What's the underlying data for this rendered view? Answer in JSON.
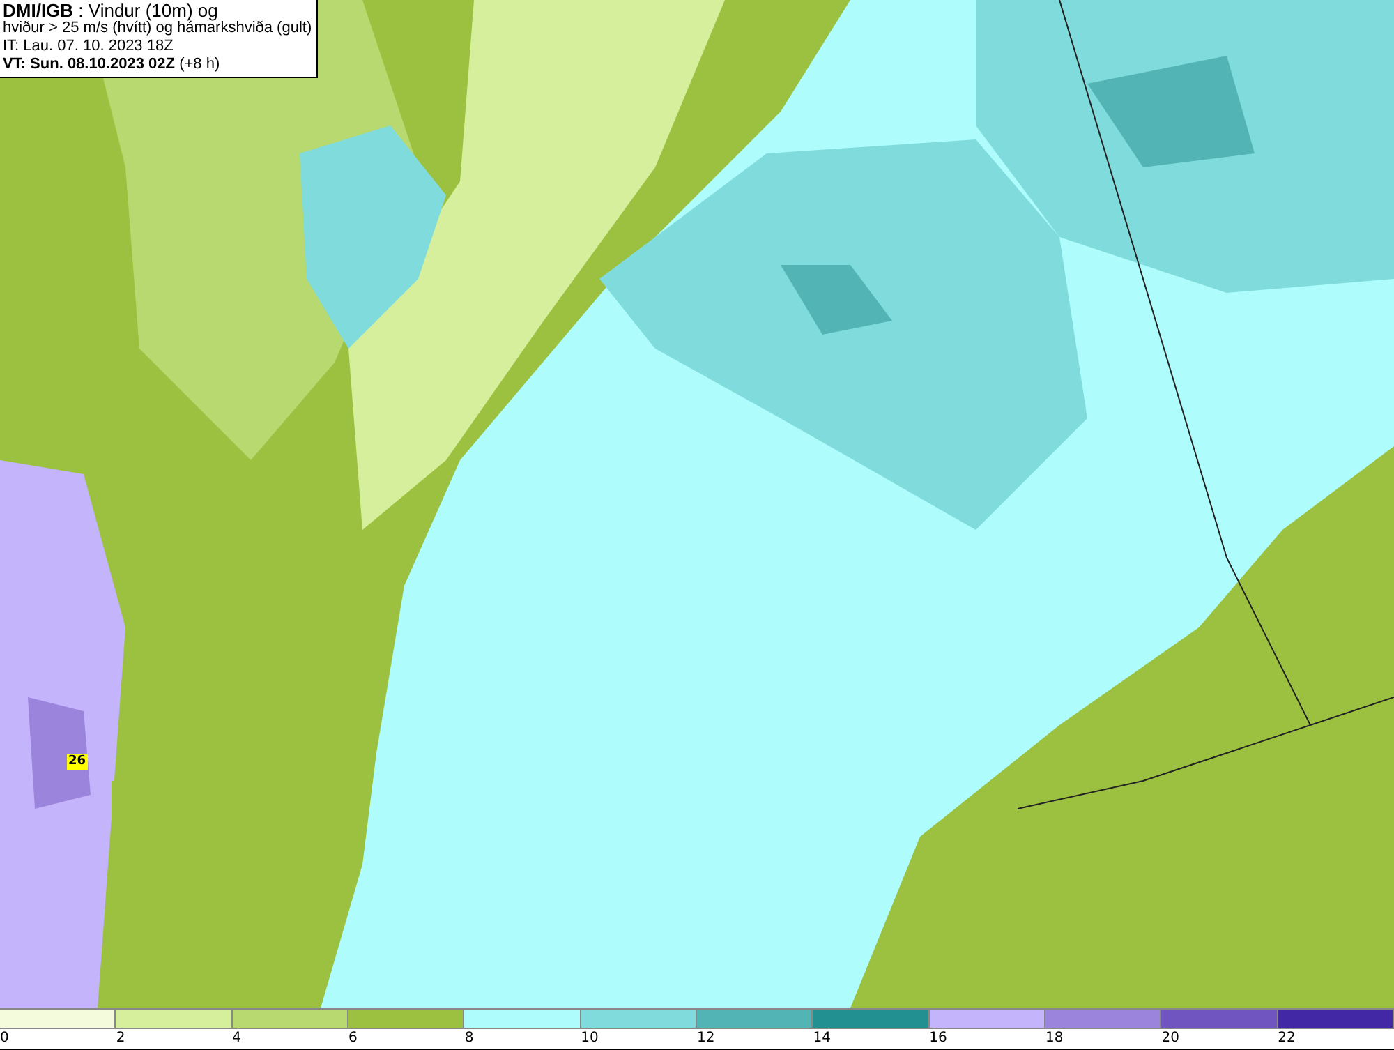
{
  "title_box": {
    "lines": [
      "**DMI/IGB** : Vindur (10m) og",
      "hviður > 25 m/s (hvítt) og hámarkshviða (gult)",
      "IT: Lau. 07. 10. 2023 18Z",
      "**VT: Sun. 08.10.2023 02Z** (+8 h)"
    ]
  },
  "map": {
    "gust_label": "26"
  },
  "legend": [
    {
      "label": "0",
      "color": "#f3fbdc"
    },
    {
      "label": "2",
      "color": "#d6ef9c"
    },
    {
      "label": "4",
      "color": "#b8d870"
    },
    {
      "label": "6",
      "color": "#9cc040"
    },
    {
      "label": "8",
      "color": "#aefcfc"
    },
    {
      "label": "10",
      "color": "#80dcdc"
    },
    {
      "label": "12",
      "color": "#52b4b4"
    },
    {
      "label": "14",
      "color": "#229090"
    },
    {
      "label": "16",
      "color": "#c4b4fc"
    },
    {
      "label": "18",
      "color": "#9a84dc"
    },
    {
      "label": "20",
      "color": "#7054c0"
    },
    {
      "label": "22",
      "color": "#4228a4"
    }
  ]
}
